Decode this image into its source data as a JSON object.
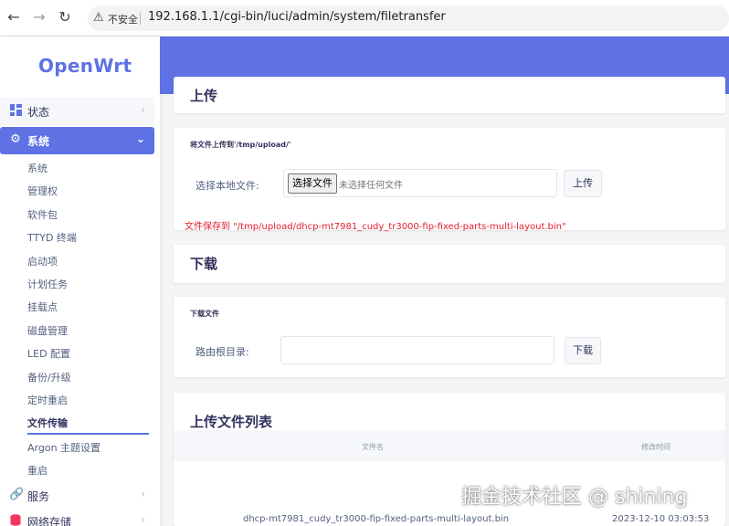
{
  "browser": {
    "back": "←",
    "forward": "→",
    "reload": "↻",
    "warning_icon": "⚠",
    "insecure_label": "不安全",
    "url": "192.168.1.1/cgi-bin/luci/admin/system/filetransfer"
  },
  "sidebar": {
    "logo": "OpenWrt",
    "status": {
      "label": "状态",
      "icon": "dashboard-icon"
    },
    "system": {
      "label": "系统",
      "icon": "gear-icon"
    },
    "sub_items": [
      "系统",
      "管理权",
      "软件包",
      "TTYD 终端",
      "启动项",
      "计划任务",
      "挂载点",
      "磁盘管理",
      "LED 配置",
      "备份/升级",
      "定时重启",
      "文件传输",
      "Argon 主题设置",
      "重启"
    ],
    "active_sub": "文件传输",
    "service": {
      "label": "服务",
      "icon": "link-icon"
    },
    "storage": {
      "label": "网络存储",
      "icon": "storage-icon"
    },
    "accent_color": "#5e72e4"
  },
  "upload": {
    "title": "上传",
    "desc": "将文件上传到'/tmp/upload/'",
    "field_label": "选择本地文件:",
    "choose_btn": "选择文件",
    "no_file": "未选择任何文件",
    "submit": "上传",
    "saved_msg": "文件保存到 \"/tmp/upload/dhcp-mt7981_cudy_tr3000-fip-fixed-parts-multi-layout.bin\""
  },
  "download": {
    "title": "下载",
    "desc": "下载文件",
    "field_label": "路由根目录:",
    "submit": "下载"
  },
  "file_list": {
    "title": "上传文件列表",
    "columns": [
      "文件名",
      "修改时间"
    ],
    "rows": [
      {
        "name": "dhcp-mt7981_cudy_tr3000-fip-fixed-parts-multi-layout.bin",
        "mtime": "2023-12-10 03:03:53"
      }
    ]
  },
  "watermark": "掘金技术社区 @ shining"
}
